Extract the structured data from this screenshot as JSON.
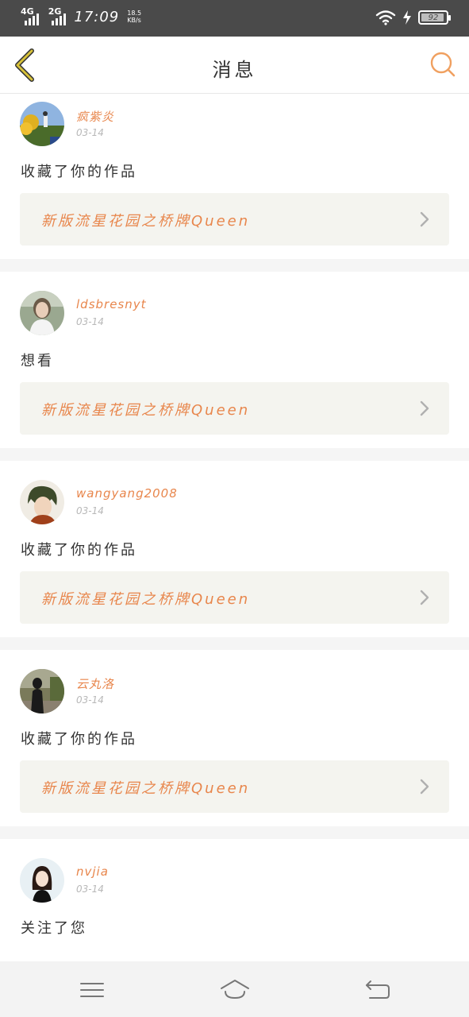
{
  "status_bar": {
    "network1": "4G",
    "network2": "2G",
    "time": "17:09",
    "speed_value": "18.5",
    "speed_unit": "KB/s",
    "battery_level": "92",
    "icons": [
      "signal-icon",
      "wifi-icon",
      "charging-icon",
      "battery-icon"
    ]
  },
  "header": {
    "title": "消息",
    "back_icon": "chevron-left-icon",
    "search_icon": "search-icon"
  },
  "messages": [
    {
      "username": "疯紫炎",
      "date": "03-14",
      "action": "收藏了你的作品",
      "work_title": "新版流星花园之桥牌Queen"
    },
    {
      "username": "ldsbresnyt",
      "date": "03-14",
      "action": "想看",
      "work_title": "新版流星花园之桥牌Queen"
    },
    {
      "username": "wangyang2008",
      "date": "03-14",
      "action": "收藏了你的作品",
      "work_title": "新版流星花园之桥牌Queen"
    },
    {
      "username": "云丸洛",
      "date": "03-14",
      "action": "收藏了你的作品",
      "work_title": "新版流星花园之桥牌Queen"
    },
    {
      "username": "nvjia",
      "date": "03-14",
      "action": "关注了您",
      "work_title": ""
    }
  ],
  "nav_bar": {
    "icons": [
      "menu-icon",
      "home-icon",
      "back-icon"
    ]
  },
  "colors": {
    "accent": "#e8864c",
    "back_arrow": "#d8c23a",
    "status_bar_bg": "#4a4a4a",
    "card_link_bg": "#f4f4ef",
    "divider_bg": "#f5f5f5"
  }
}
